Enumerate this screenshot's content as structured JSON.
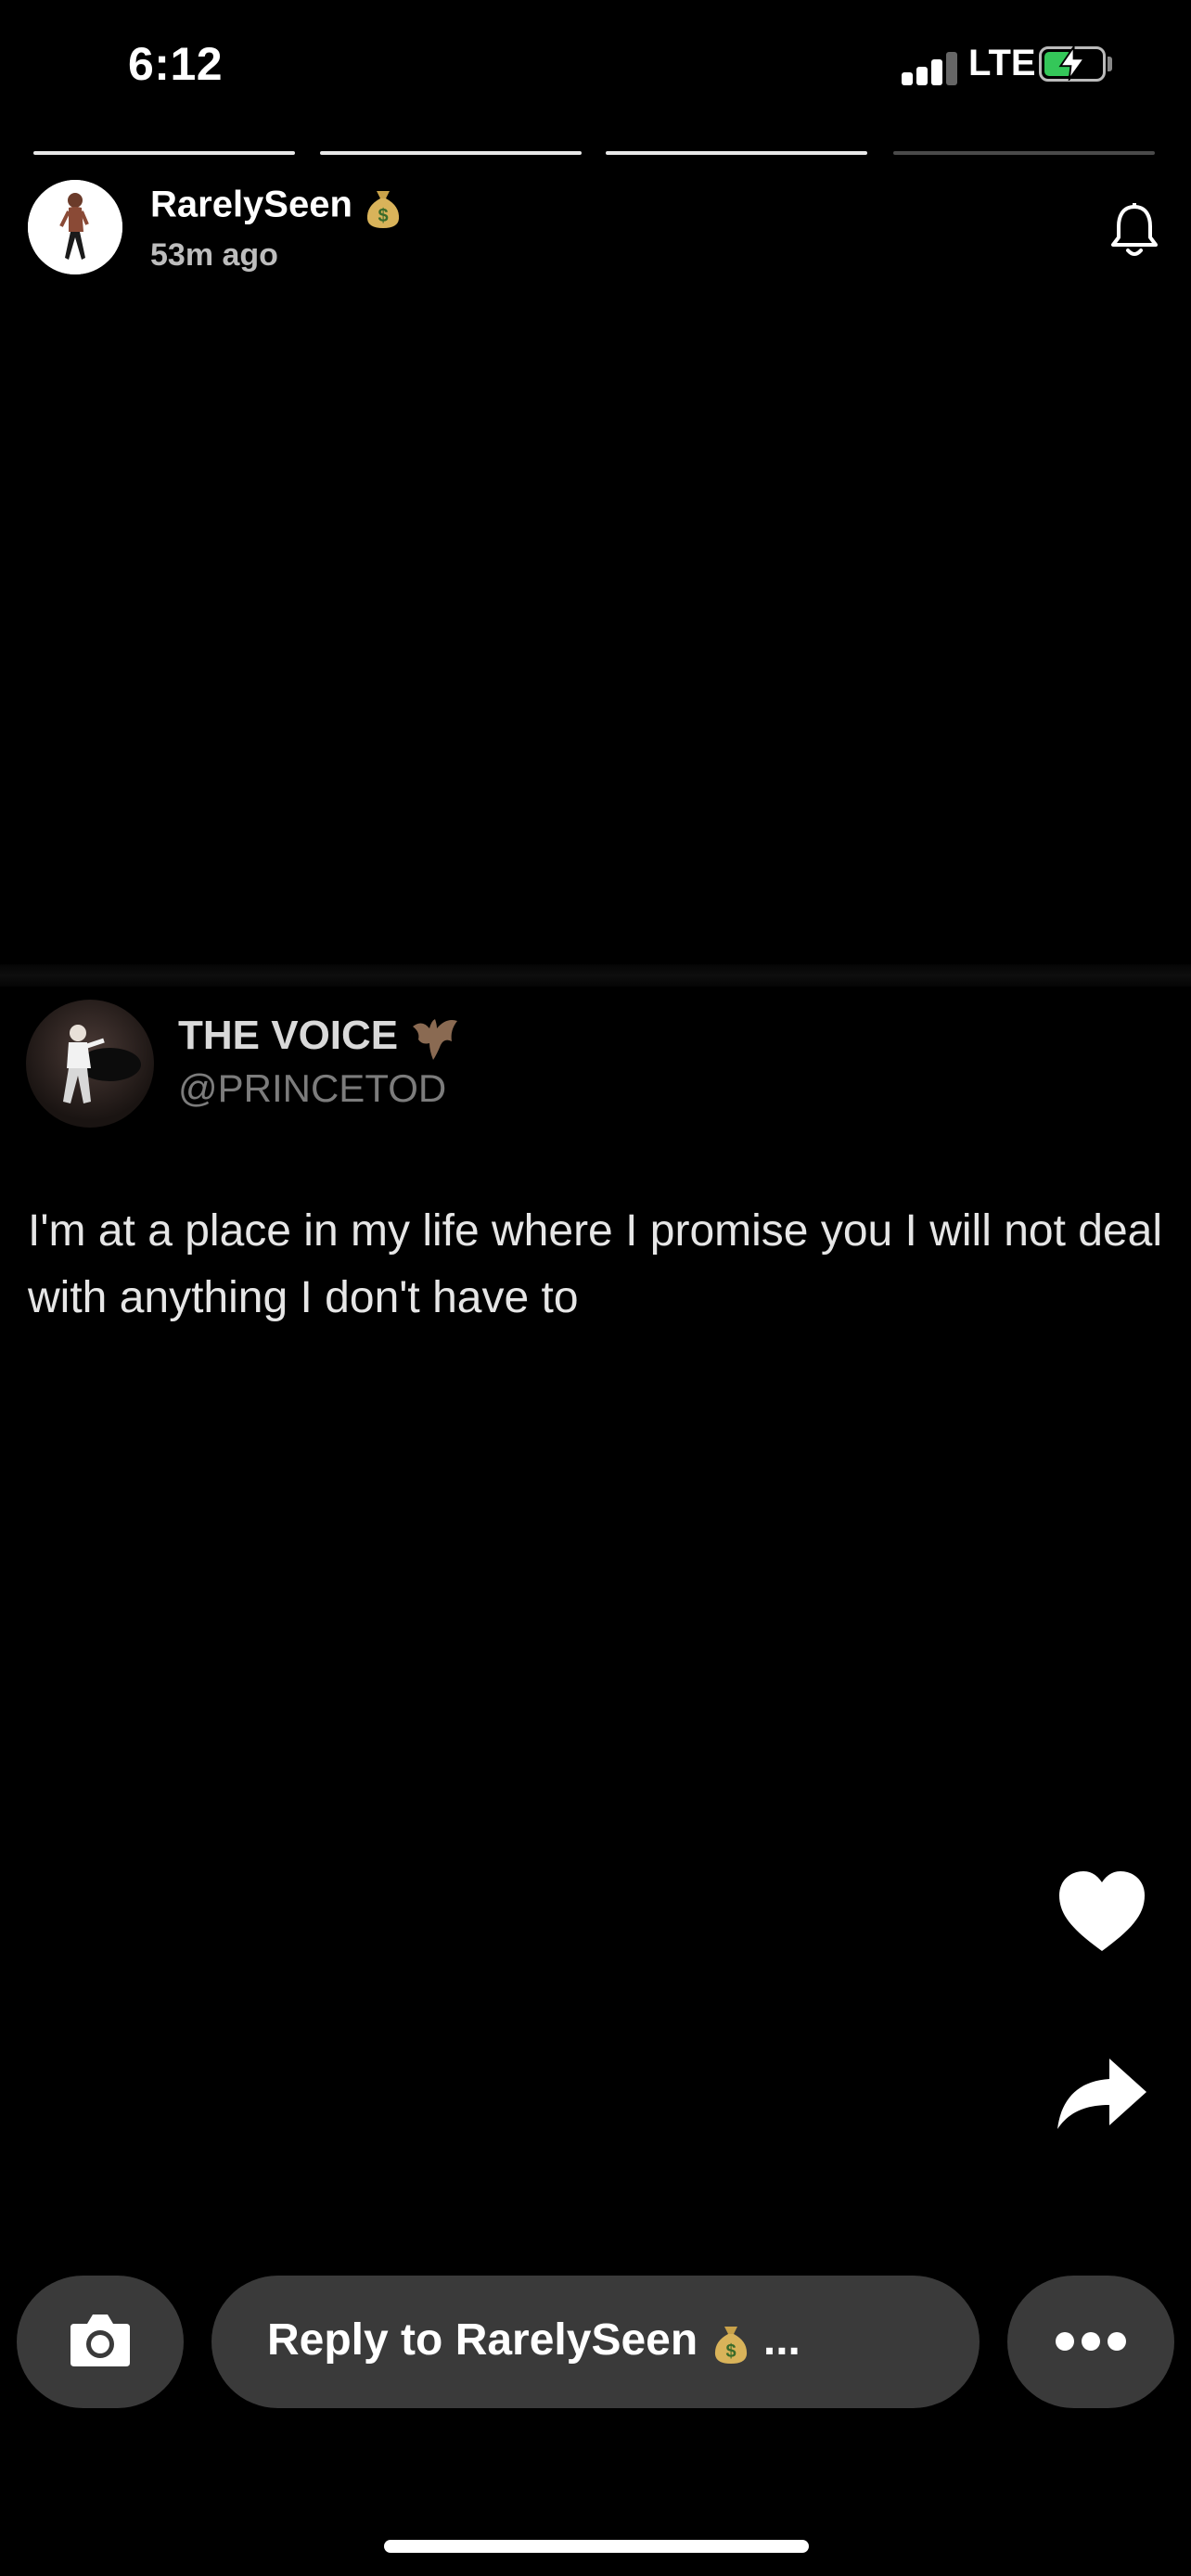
{
  "status_bar": {
    "time": "6:12",
    "network": "LTE",
    "battery_charging": true,
    "signal_bars": 4
  },
  "story": {
    "progress_segments": 4,
    "active_segment": 3,
    "username": "RarelySeen",
    "username_emoji": "money-bag-icon",
    "posted_ago": "53m ago",
    "bell_icon": "bell-icon"
  },
  "tweet": {
    "display_name": "THE VOICE",
    "name_emoji": "bat-icon",
    "handle": "@PRINCETOD",
    "text": "I'm at a place in my life where I promise you I will not deal with anything I don't have to"
  },
  "actions": {
    "like_icon": "heart-icon",
    "share_icon": "share-arrow-icon"
  },
  "reply_bar": {
    "camera_icon": "camera-icon",
    "placeholder": "Reply to RarelySeen",
    "placeholder_suffix": "...",
    "more_icon": "ellipsis-icon"
  },
  "colors": {
    "background": "#000000",
    "pill": "#3a3a3a",
    "battery_fill": "#34c759"
  }
}
